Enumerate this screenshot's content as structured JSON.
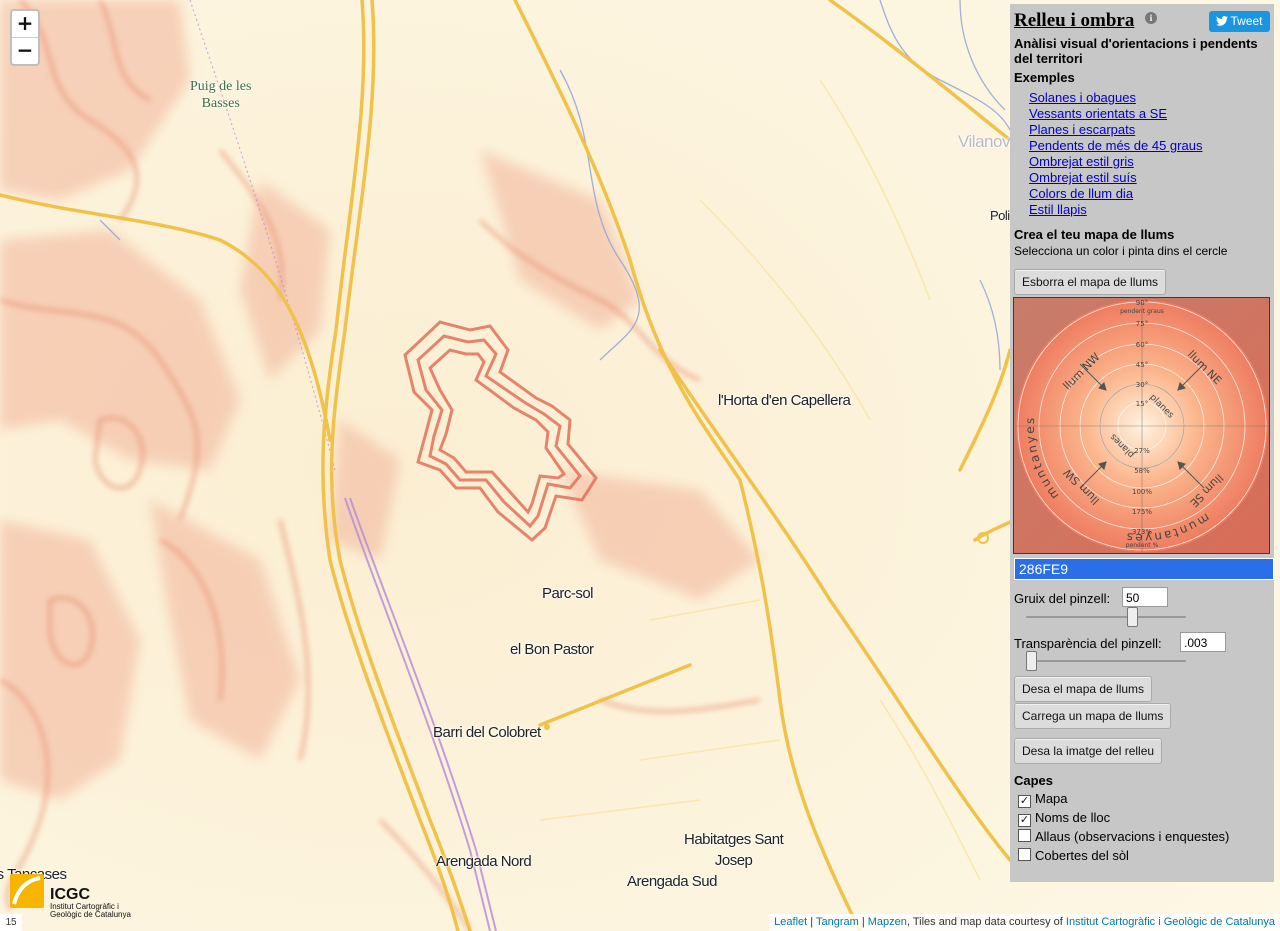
{
  "map": {
    "zoom_in": "+",
    "zoom_out": "−",
    "places": [
      {
        "id": "puig",
        "text": "Puig de les\nBasses"
      },
      {
        "id": "horta",
        "text": "l'Horta d'en Capellera"
      },
      {
        "id": "parcsol",
        "text": "Parc-sol"
      },
      {
        "id": "bonpastor",
        "text": "el Bon Pastor"
      },
      {
        "id": "colobret",
        "text": "Barri del Colobret"
      },
      {
        "id": "arengadanord",
        "text": "Arengada Nord"
      },
      {
        "id": "arengadasud",
        "text": "Arengada Sud"
      },
      {
        "id": "habitatges",
        "text": "Habitatges Sant\nJosep"
      },
      {
        "id": "tancases",
        "text": "les Tancases"
      },
      {
        "id": "vilanova",
        "text": "Vilanova i la Roca"
      },
      {
        "id": "poli",
        "text": "Poli"
      }
    ],
    "zoom_level": "15",
    "logo": {
      "name": "ICGC",
      "sub": "Institut Cartogràfic i Geològic de Catalunya"
    },
    "attribution": {
      "leaflet": "Leaflet",
      "sep1": " | ",
      "tangram": "Tangram",
      "sep2": " | ",
      "mapzen": "Mapzen",
      "text": ", Tiles and map data courtesy of ",
      "icgc": "Institut Cartogràfic i Geològic de Catalunya"
    }
  },
  "panel": {
    "title": "Relleu i ombra",
    "info_icon": "i",
    "tweet": "Tweet",
    "subtitle": "Anàlisi visual d'orientacions i pendents del territori",
    "examples_heading": "Exemples",
    "examples": [
      "Solanes i obagues",
      "Vessants orientats a SE",
      "Planes i escarpats",
      "Pendents de més de 45 graus",
      "Ombrejat estil gris",
      "Ombrejat estil suís",
      "Colors de llum dia",
      "Estil llapis"
    ],
    "create_heading": "Crea el teu mapa de llums",
    "create_hint": "Selecciona un color i pinta dins el cercle",
    "clear_button": "Esborra el mapa de llums",
    "wheel": {
      "top_label": "pendent graus",
      "degree_labels": [
        "90°",
        "75°",
        "60°",
        "45°",
        "30°",
        "15°"
      ],
      "percent_labels": [
        "27%",
        "58%",
        "100%",
        "175%",
        "373%"
      ],
      "percent_label": "pendent %",
      "muntanyes": "muntanyes",
      "planes": "planes",
      "llum_nw": "llum NW",
      "llum_ne": "llum NE",
      "llum_sw": "llum SW",
      "llum_se": "llum SE"
    },
    "color_value": "286FE9",
    "brush_width_label": "Gruix del pinzell:",
    "brush_width": "50",
    "brush_width_level": 0.68,
    "brush_opacity_label": "Transparència del pinzell:",
    "brush_opacity": ".003",
    "brush_opacity_level": 0.0,
    "save_button": "Desa el mapa de llums",
    "load_button": "Carrega un mapa de llums",
    "save_image_button": "Desa la imatge del relleu",
    "layers_heading": "Capes",
    "layers": [
      {
        "label": "Mapa",
        "checked": true
      },
      {
        "label": "Noms de lloc",
        "checked": true
      },
      {
        "label": "Allaus (observacions i enquestes)",
        "checked": false
      },
      {
        "label": "Cobertes del sòl",
        "checked": false
      }
    ]
  },
  "colors": {
    "terrain_bg": "#fbf5de",
    "relief": "#e88a6a",
    "road": "#f0c24a",
    "stream": "#8a9fd8",
    "rail": "#b58ad8",
    "panel_bg": "#c7c7c7",
    "link": "#0000cc",
    "color_box": "#2a6fe8"
  }
}
